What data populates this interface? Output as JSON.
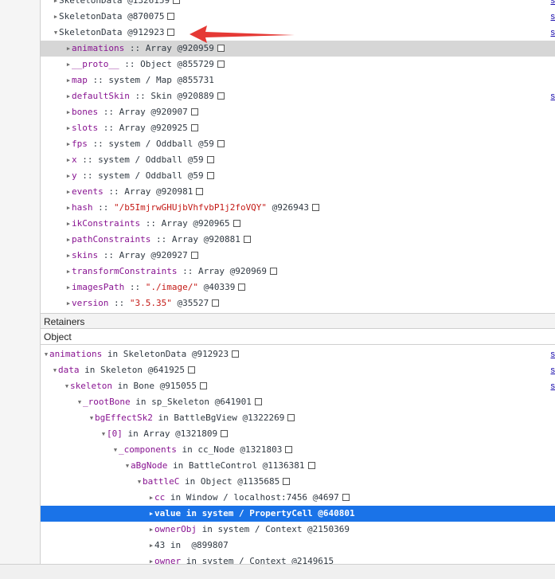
{
  "top_rows": [
    {
      "label": "SkeletonData",
      "rest": " @1326159",
      "link": "s",
      "tri": "▶",
      "indent": 66
    },
    {
      "label": "SkeletonData",
      "rest": " @870075",
      "link": "s",
      "tri": "▶",
      "indent": 66
    },
    {
      "label": "SkeletonData",
      "rest": " @912923",
      "link": "s",
      "tri": "▼",
      "indent": 66
    },
    {
      "prop": "animations",
      "rest": " :: Array @920959",
      "tri": "▶",
      "indent": 82,
      "selected": "gray"
    },
    {
      "prop": "__proto__",
      "rest": " :: Object @855729",
      "tri": "▶",
      "indent": 82
    },
    {
      "prop": "map",
      "rest": " :: system / Map @855731",
      "tri": "▶",
      "indent": 82,
      "nobox": true
    },
    {
      "prop": "defaultSkin",
      "rest": " :: Skin @920889",
      "link": "s",
      "tri": "▶",
      "indent": 82
    },
    {
      "prop": "bones",
      "rest": " :: Array @920907",
      "tri": "▶",
      "indent": 82
    },
    {
      "prop": "slots",
      "rest": " :: Array @920925",
      "tri": "▶",
      "indent": 82
    },
    {
      "prop": "fps",
      "rest": " :: system / Oddball @59",
      "tri": "▶",
      "indent": 82
    },
    {
      "prop": "x",
      "rest": " :: system / Oddball @59",
      "tri": "▶",
      "indent": 82
    },
    {
      "prop": "y",
      "rest": " :: system / Oddball @59",
      "tri": "▶",
      "indent": 82
    },
    {
      "prop": "events",
      "rest": " :: Array @920981",
      "tri": "▶",
      "indent": 82
    },
    {
      "prop": "hash",
      "rest_pre": " :: ",
      "str": "\"/b5ImjrwGHUjbVhfvbP1j2foVQY\"",
      "rest": " @926943",
      "tri": "▶",
      "indent": 82
    },
    {
      "prop": "ikConstraints",
      "rest": " :: Array @920965",
      "tri": "▶",
      "indent": 82
    },
    {
      "prop": "pathConstraints",
      "rest": " :: Array @920881",
      "tri": "▶",
      "indent": 82
    },
    {
      "prop": "skins",
      "rest": " :: Array @920927",
      "tri": "▶",
      "indent": 82
    },
    {
      "prop": "transformConstraints",
      "rest": " :: Array @920969",
      "tri": "▶",
      "indent": 82
    },
    {
      "prop": "imagesPath",
      "rest_pre": " :: ",
      "str": "\"./image/\"",
      "rest": " @40339",
      "tri": "▶",
      "indent": 82
    },
    {
      "prop": "version",
      "rest_pre": " :: ",
      "str": "\"3.5.35\"",
      "rest": " @35527",
      "tri": "▶",
      "indent": 82
    }
  ],
  "retainers_title": "Retainers",
  "object_column_title": "Object",
  "bottom_rows": [
    {
      "prop": "animations",
      "rest": " in SkeletonData @912923",
      "link": "s",
      "tri": "▼",
      "indent": 54
    },
    {
      "prop": "data",
      "rest": " in Skeleton @641925",
      "link": "s",
      "tri": "▼",
      "indent": 65
    },
    {
      "prop": "skeleton",
      "rest": " in Bone @915055",
      "link": "s",
      "tri": "▼",
      "indent": 80
    },
    {
      "prop": "_rootBone",
      "rest": " in sp_Skeleton @641901",
      "tri": "▼",
      "indent": 96
    },
    {
      "prop": "bgEffectSk2",
      "rest": " in BattleBgView @1322269",
      "tri": "▼",
      "indent": 111
    },
    {
      "prop": "[0]",
      "rest": " in Array @1321809",
      "tri": "▼",
      "indent": 126
    },
    {
      "prop": "_components",
      "rest": " in cc_Node @1321803",
      "tri": "▼",
      "indent": 141
    },
    {
      "prop": "aBgNode",
      "rest": " in BattleControl @1136381",
      "tri": "▼",
      "indent": 156
    },
    {
      "prop": "battleC",
      "rest": " in Object @1135685",
      "tri": "▼",
      "indent": 171
    },
    {
      "prop": "cc",
      "rest": " in Window / localhost:7456 @4697",
      "tri": "▶",
      "indent": 186
    },
    {
      "prop": "value",
      "rest": " in system / PropertyCell @640801",
      "tri": "▶",
      "indent": 186,
      "selected": "blue",
      "nobox": true
    },
    {
      "prop": "ownerObj",
      "rest": " in system / Context @2150369",
      "tri": "▶",
      "indent": 186,
      "nobox": true
    },
    {
      "prop": "43",
      "rest": " in  @899807",
      "tri": "▶",
      "indent": 186,
      "plain": true,
      "nobox": true
    },
    {
      "prop": "owner",
      "rest": " in system / Context @2149615",
      "tri": "▶",
      "indent": 186,
      "nobox": true
    }
  ],
  "colors": {
    "selected_blue": "#1a73e8",
    "arrow_red": "#e53935",
    "property": "#881391",
    "string": "#c41a16"
  }
}
